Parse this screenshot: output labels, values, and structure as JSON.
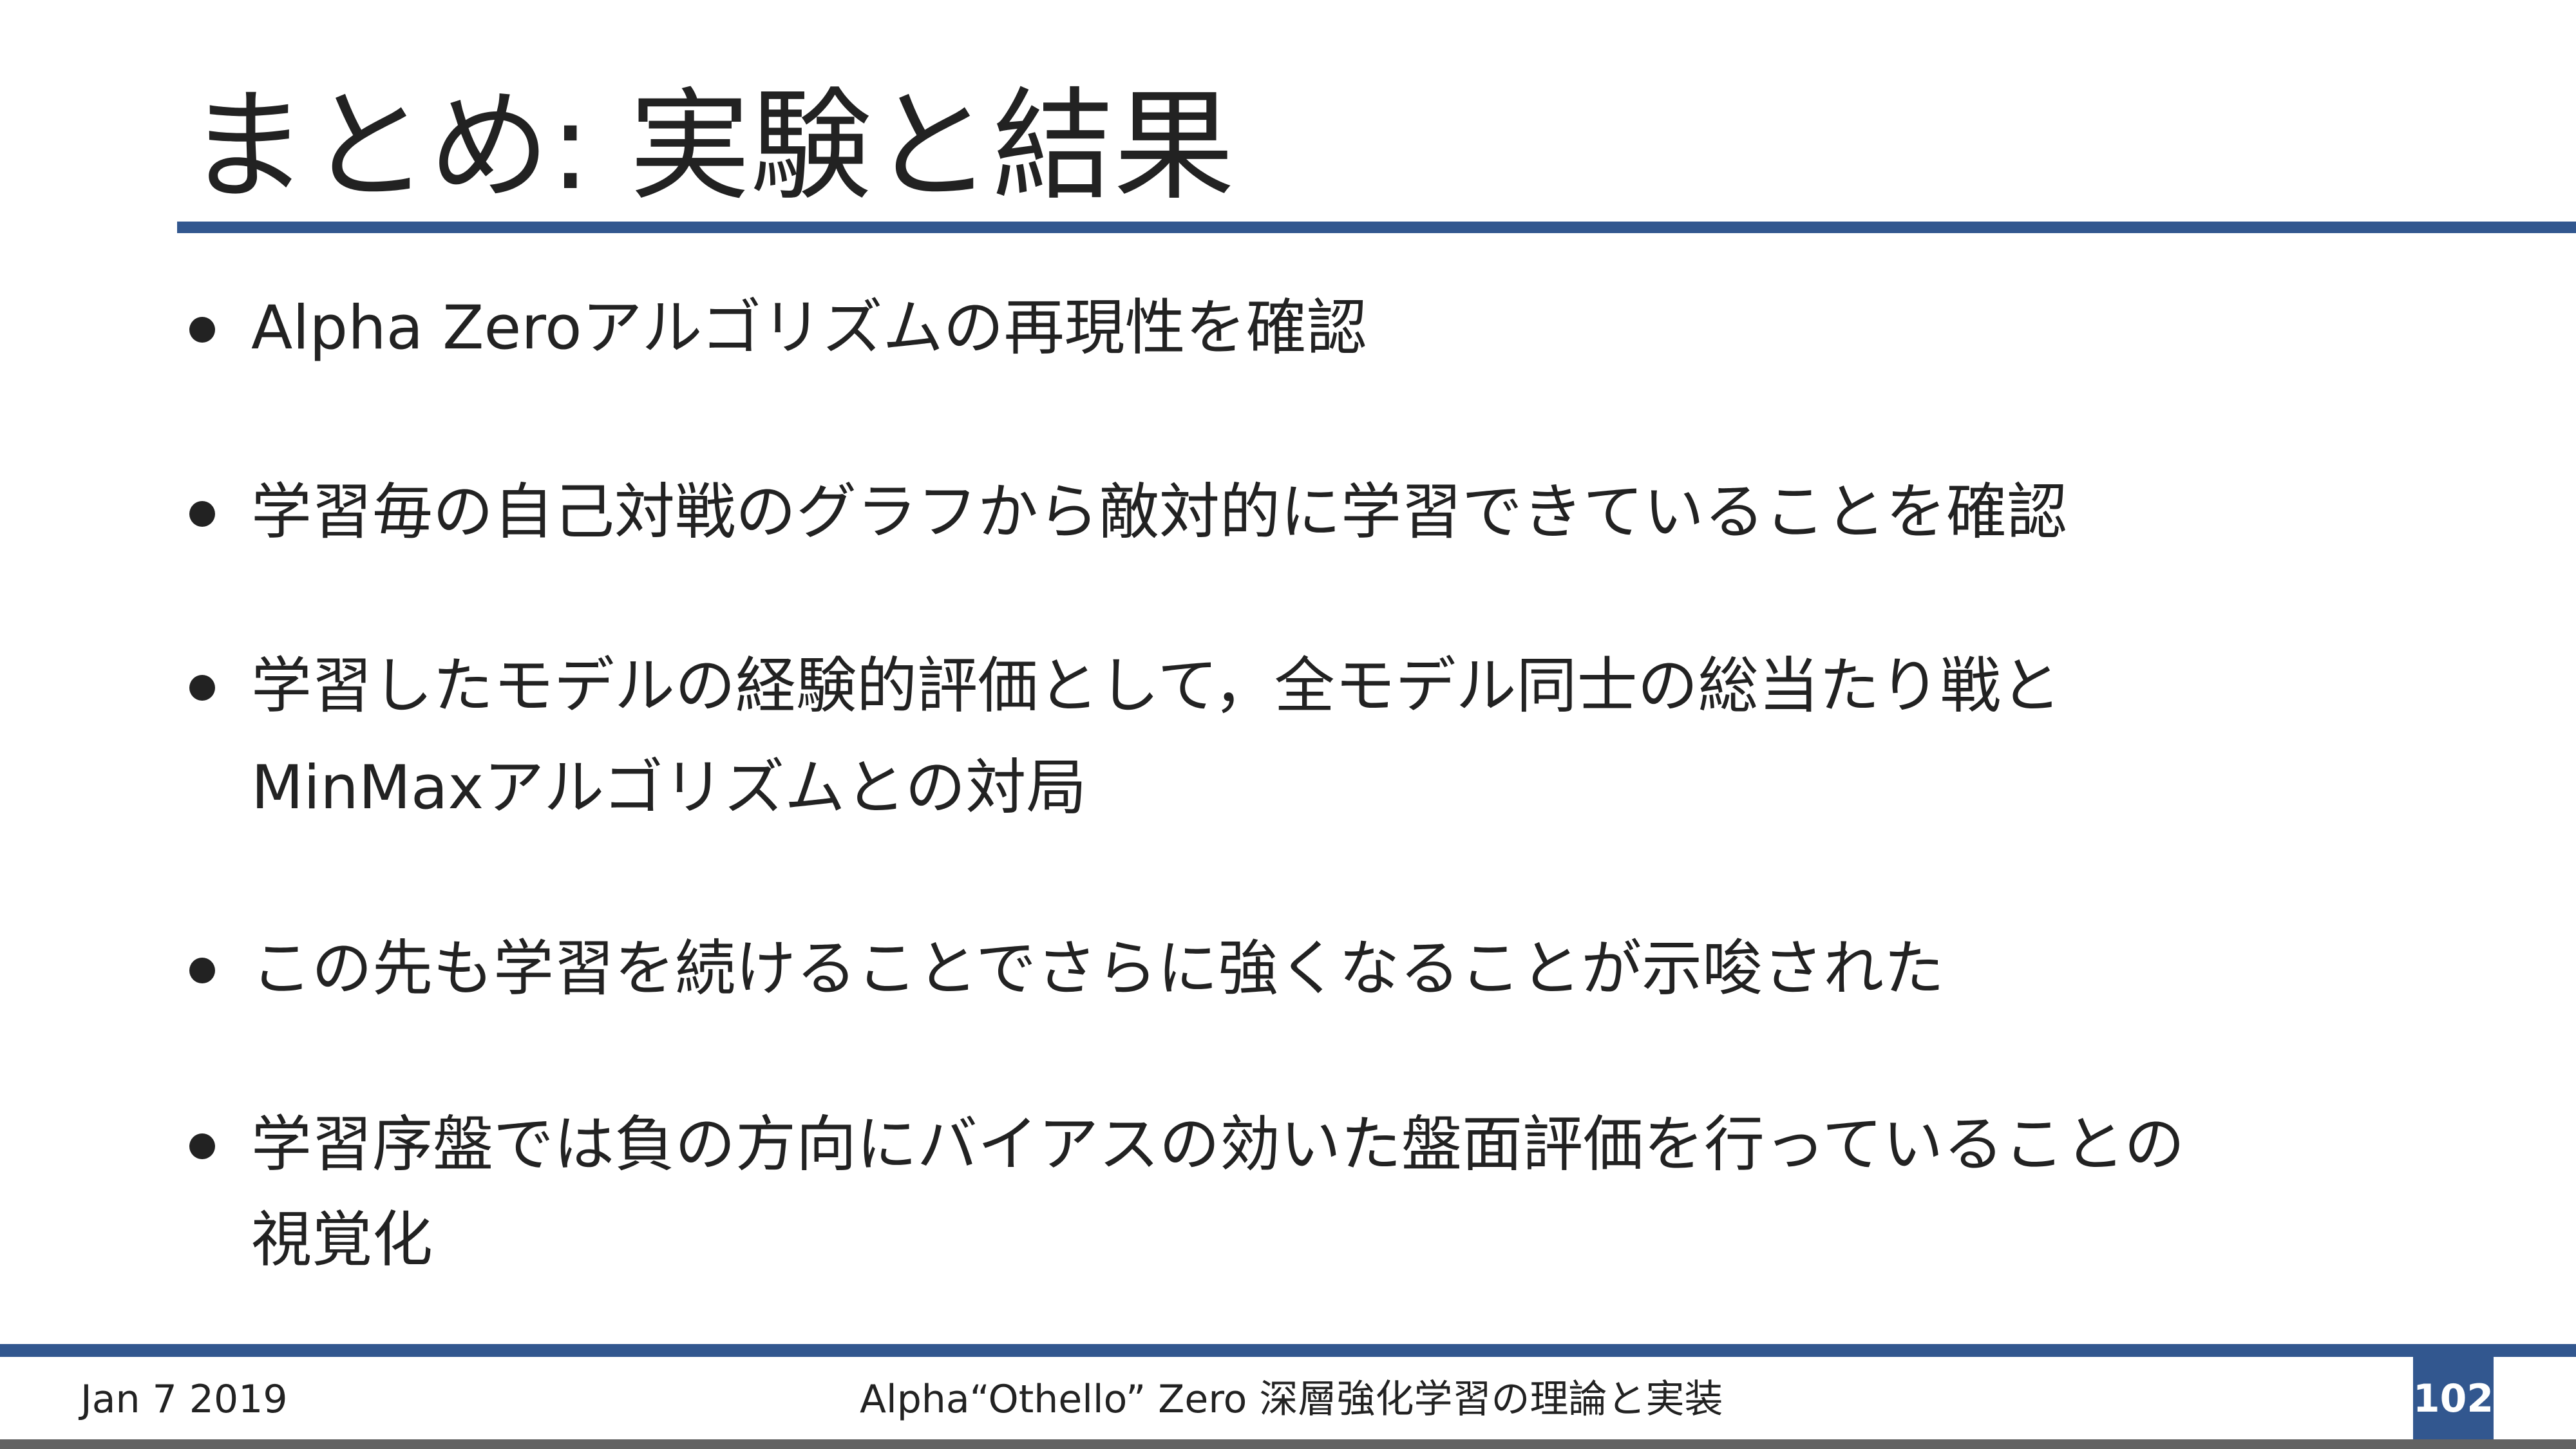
{
  "slide": {
    "title": "まとめ: 実験と結果",
    "bullets": [
      {
        "lines": [
          "Alpha Zeroアルゴリズムの再現性を確認"
        ]
      },
      {
        "lines": [
          "学習毎の自己対戦のグラフから敵対的に学習できていることを確認"
        ]
      },
      {
        "lines": [
          "学習したモデルの経験的評価として，全モデル同士の総当たり戦と",
          "MinMaxアルゴリズムとの対局"
        ]
      },
      {
        "lines": [
          "この先も学習を続けることでさらに強くなることが示唆された"
        ]
      },
      {
        "lines": [
          "学習序盤では負の方向にバイアスの効いた盤面評価を行っていることの",
          "視覚化"
        ]
      }
    ]
  },
  "footer": {
    "date": "Jan 7 2019",
    "presentation_title": "Alpha“Othello” Zero  深層強化学習の理論と実装",
    "page_number": "102"
  },
  "colors": {
    "accent": "#32578f",
    "text": "#222222",
    "bottom_bar": "#636363"
  }
}
